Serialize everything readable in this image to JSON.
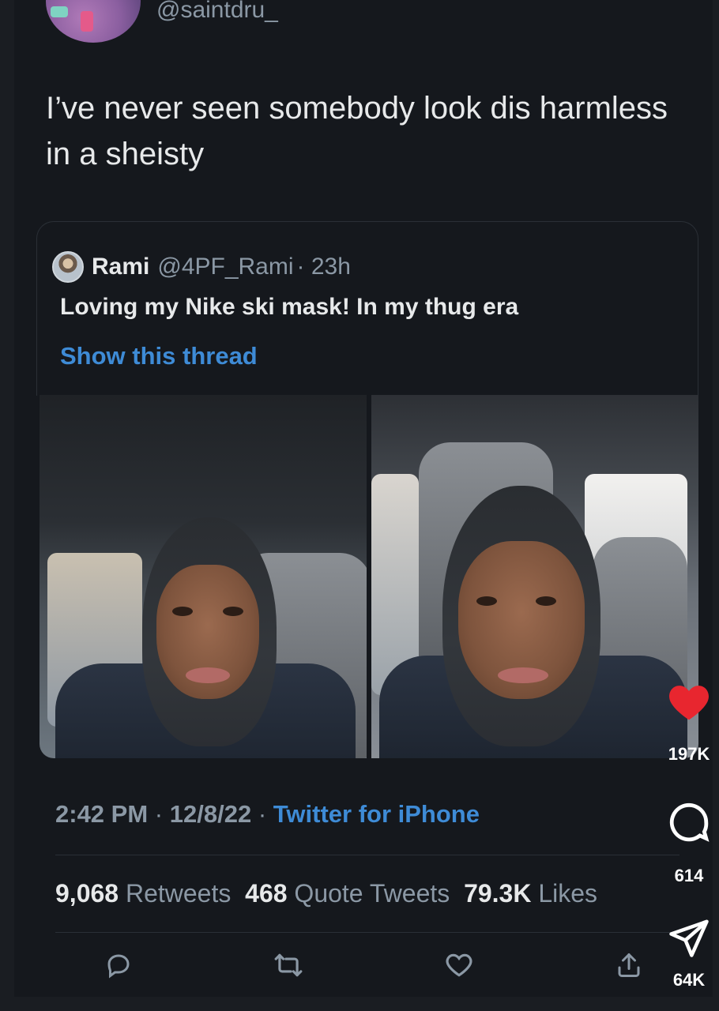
{
  "colors": {
    "background": "#15181d",
    "text_primary": "#e7e9ea",
    "text_secondary": "#8b98a5",
    "link": "#3e8bd6",
    "like_heart": "#e8262f"
  },
  "tweet": {
    "handle": "@saintdru_",
    "text": "I’ve never seen somebody look dis harmless in a sheisty"
  },
  "quote": {
    "name": "Rami",
    "handle": "@4PF_Rami",
    "time": "· 23h",
    "text": "Loving my Nike ski mask! In my thug era",
    "show_thread": "Show this thread"
  },
  "meta": {
    "time": "2:42 PM",
    "sep1": "·",
    "date": "12/8/22",
    "sep2": "·",
    "source": "Twitter for iPhone"
  },
  "stats": {
    "retweets_count": "9,068",
    "retweets_label": "Retweets",
    "quotes_count": "468",
    "quotes_label": "Quote Tweets",
    "likes_count": "79.3K",
    "likes_label": "Likes"
  },
  "actions": {
    "reply_icon": "reply-icon",
    "retweet_icon": "retweet-icon",
    "like_icon": "heart-icon",
    "share_icon": "share-icon"
  },
  "overlay": {
    "likes": "197K",
    "comments": "614",
    "shares": "64K"
  }
}
